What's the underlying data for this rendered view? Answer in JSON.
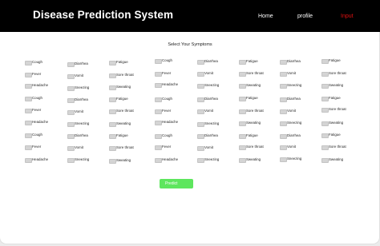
{
  "header": {
    "title": "Disease Prediction System",
    "nav": {
      "home": "Home",
      "profile": "profile",
      "input": "Input"
    },
    "accent_active_nav": "#e01010"
  },
  "symptoms_section": {
    "title": "Select Your Symptoms",
    "columns": [
      [
        "Cough",
        "Fever",
        "Headache",
        "Cough",
        "Fever",
        "Headache",
        "Cough",
        "Fever",
        "Headache"
      ],
      [
        "Diarrhea",
        "Vomit",
        "Sneezing",
        "Diarrhea",
        "Vomit",
        "Sneezing",
        "Diarrhea",
        "Vomit",
        "Sneezing"
      ],
      [
        "Fatigue",
        "Sore throat",
        "Sweating",
        "Fatigue",
        "Sore throat",
        "Sweating",
        "Fatigue",
        "Sore throat",
        "Sweating"
      ],
      [
        "Cough",
        "Fever",
        "Headache",
        "Cough",
        "Fever",
        "Headache",
        "Cough",
        "Fever",
        "Headache"
      ],
      [
        "Diarrhea",
        "Vomit",
        "Sneezing",
        "Diarrhea",
        "Vomit",
        "Sneezing",
        "Diarrhea",
        "Vomit",
        "Sneezing"
      ],
      [
        "Fatigue",
        "Sore throat",
        "Sweating",
        "Fatigue",
        "Sore throat",
        "Sweating",
        "Fatigue",
        "Sore throat",
        "Sweating"
      ],
      [
        "Diarrhea",
        "Vomit",
        "Sneezing",
        "Diarrhea",
        "Vomit",
        "Sneezing",
        "Diarrhea",
        "Vomit",
        "Sneezing"
      ],
      [
        "Fatigue",
        "Sore throat",
        "Sweating",
        "Fatigue",
        "Sore throat",
        "Sweating",
        "Fatigue",
        "Sore throat",
        "Sweating"
      ]
    ]
  },
  "predict_button": {
    "label": "Predict",
    "color": "#5ee65e"
  }
}
